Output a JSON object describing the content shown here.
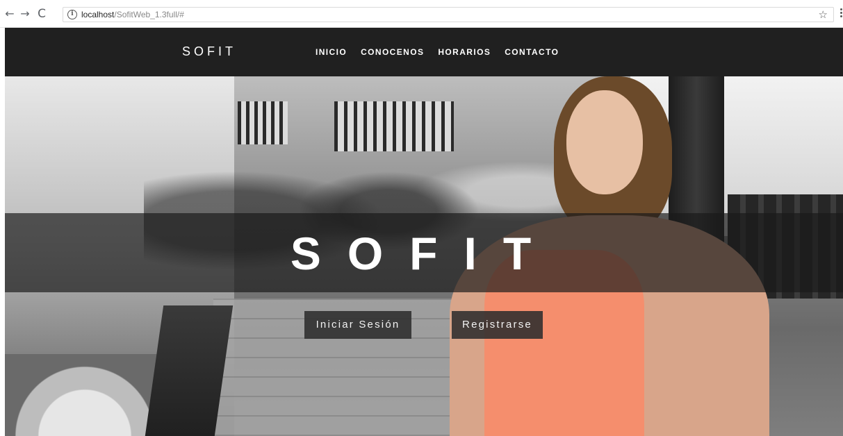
{
  "browser": {
    "url_host": "localhost",
    "url_path": "/SofitWeb_1.3full/#",
    "icons": {
      "back": "arrow-left",
      "forward": "arrow-right",
      "reload": "reload",
      "info": "info-circle",
      "bookmark": "star",
      "menu": "vertical-dots"
    }
  },
  "navbar": {
    "brand": "SOFIT",
    "links": [
      "INICIO",
      "CONOCENOS",
      "HORARIOS",
      "CONTACTO"
    ]
  },
  "hero": {
    "title": "SOFIT",
    "login_label": "Iniciar Sesión",
    "register_label": "Registrarse"
  },
  "colors": {
    "navbar_bg": "#202020",
    "top_accent": "#f58e6d"
  }
}
